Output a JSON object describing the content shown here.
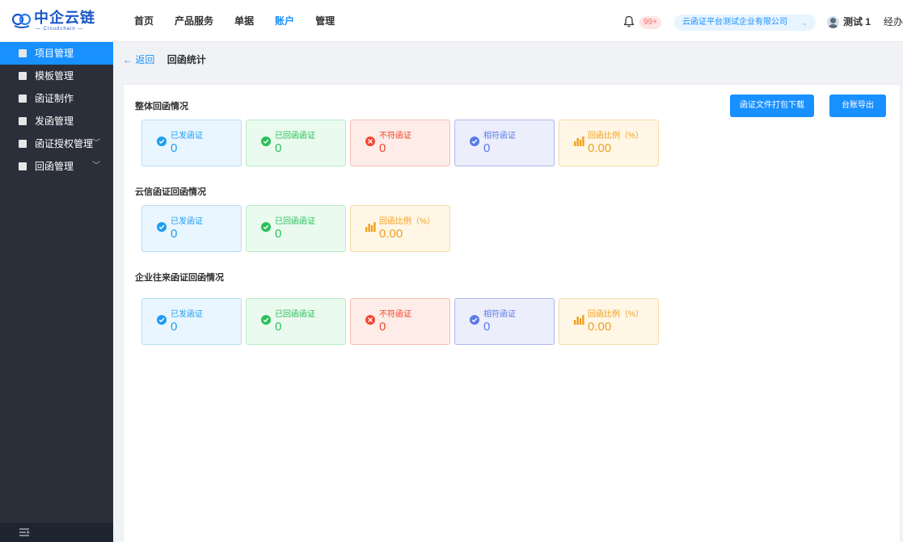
{
  "app": {
    "logo_brand": "中企云链",
    "logo_sub": "— Cloudchain —"
  },
  "topnav": {
    "items": [
      {
        "label": "首页",
        "active": false
      },
      {
        "label": "产品服务",
        "active": false
      },
      {
        "label": "单据",
        "active": false
      },
      {
        "label": "账户",
        "active": true
      },
      {
        "label": "管理",
        "active": false
      }
    ],
    "notification_badge": "99+",
    "company": "云函证平台测试企业有限公司",
    "username": "测试 1",
    "cutoff_text": "经办"
  },
  "sidebar": {
    "items": [
      {
        "label": "项目管理",
        "active": true,
        "expandable": false
      },
      {
        "label": "模板管理",
        "active": false,
        "expandable": false
      },
      {
        "label": "函证制作",
        "active": false,
        "expandable": false
      },
      {
        "label": "发函管理",
        "active": false,
        "expandable": false
      },
      {
        "label": "函证授权管理",
        "active": false,
        "expandable": true
      },
      {
        "label": "回函管理",
        "active": false,
        "expandable": true
      }
    ]
  },
  "breadcrumb": {
    "back": "← 返回",
    "title": "回函统计"
  },
  "actions": {
    "download": "函证文件打包下载",
    "export": "台账导出"
  },
  "sections": [
    {
      "title": "整体回函情况",
      "cards": [
        {
          "label": "已发函证",
          "value": "0",
          "color": "blue",
          "icon": "check-circle-icon"
        },
        {
          "label": "已回函函证",
          "value": "0",
          "color": "green",
          "icon": "check-circle-icon"
        },
        {
          "label": "不符函证",
          "value": "0",
          "color": "red",
          "icon": "close-circle-icon"
        },
        {
          "label": "相符函证",
          "value": "0",
          "color": "indigo",
          "icon": "check-circle-icon"
        },
        {
          "label": "回函比例（%）",
          "value": "0.00",
          "color": "orange",
          "icon": "bar-chart-icon"
        }
      ]
    },
    {
      "title": "云信函证回函情况",
      "cards": [
        {
          "label": "已发函证",
          "value": "0",
          "color": "blue",
          "icon": "check-circle-icon"
        },
        {
          "label": "已回函函证",
          "value": "0",
          "color": "green",
          "icon": "check-circle-icon"
        },
        {
          "label": "回函比例（%）",
          "value": "0.00",
          "color": "orange",
          "icon": "bar-chart-icon"
        }
      ]
    },
    {
      "title": "企业往来函证回函情况",
      "cards": [
        {
          "label": "已发函证",
          "value": "0",
          "color": "blue",
          "icon": "check-circle-icon"
        },
        {
          "label": "已回函函证",
          "value": "0",
          "color": "green",
          "icon": "check-circle-icon"
        },
        {
          "label": "不符函证",
          "value": "0",
          "color": "red",
          "icon": "close-circle-icon"
        },
        {
          "label": "相符函证",
          "value": "0",
          "color": "indigo",
          "icon": "check-circle-icon"
        },
        {
          "label": "回函比例（%）",
          "value": "0.00",
          "color": "orange",
          "icon": "bar-chart-icon"
        }
      ]
    }
  ],
  "colors": {
    "accent": "#1890ff",
    "sidebar_bg": "#2b2f3a",
    "blue": "#1e9ef0",
    "green": "#2bbf5b",
    "red": "#f0462f",
    "indigo": "#5a7ae8",
    "orange": "#f0a020"
  }
}
